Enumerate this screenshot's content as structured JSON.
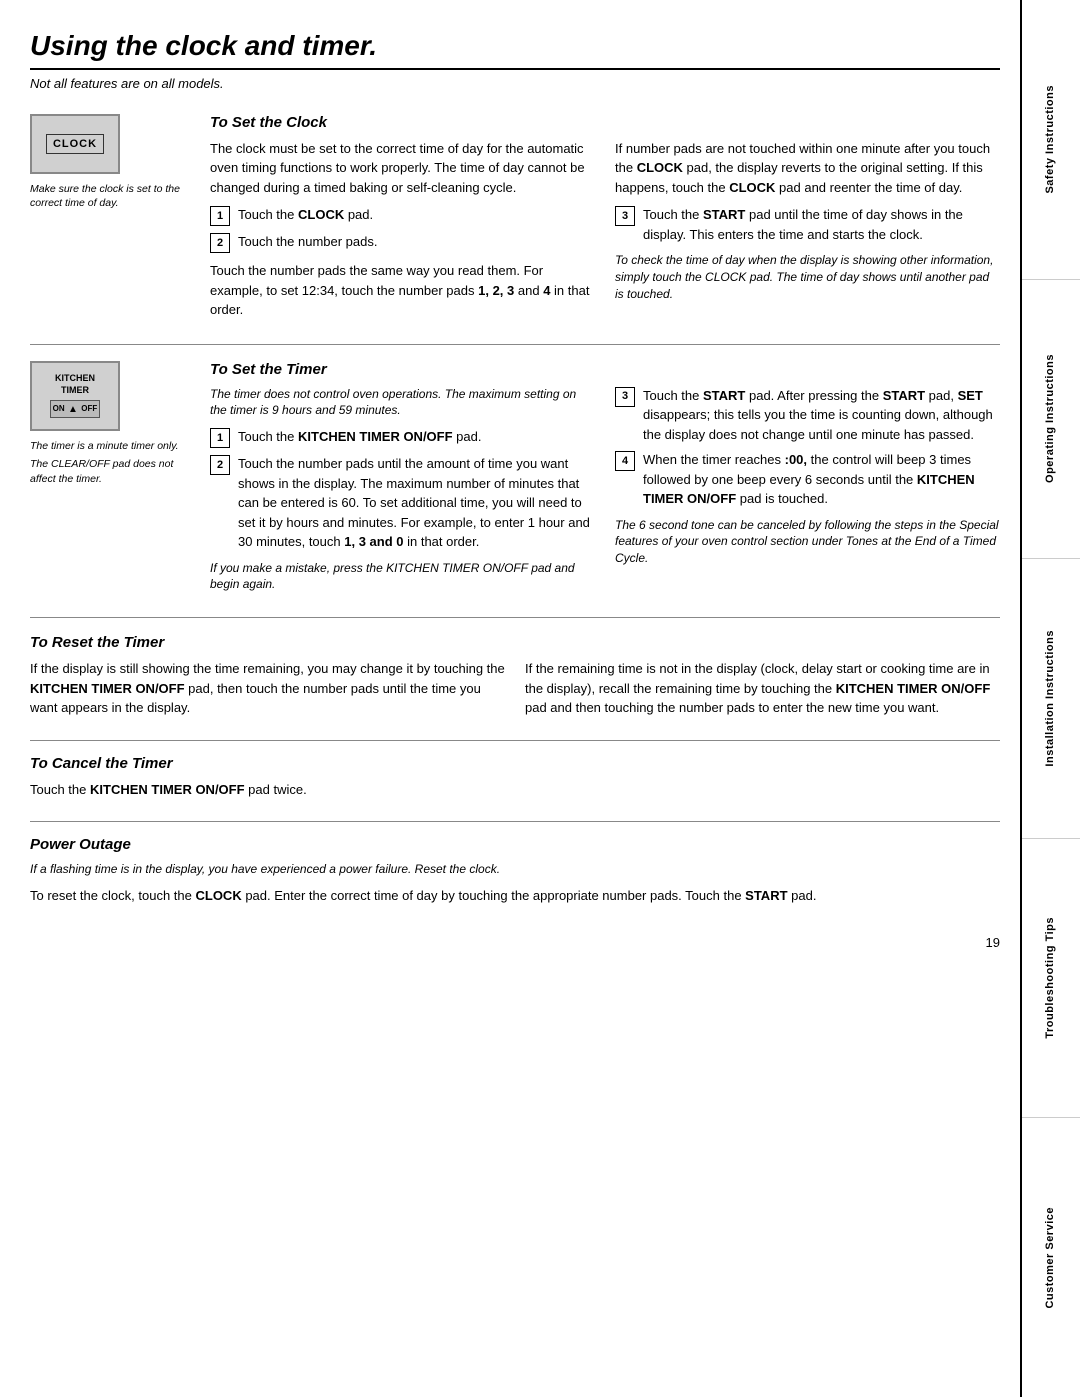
{
  "page": {
    "title": "Using the clock and timer.",
    "subtitle": "Not all features are on all models.",
    "page_number": "19"
  },
  "sidebar": {
    "sections": [
      {
        "label": "Safety Instructions"
      },
      {
        "label": "Operating Instructions"
      },
      {
        "label": "Installation Instructions"
      },
      {
        "label": "Troubleshooting Tips"
      },
      {
        "label": "Customer Service"
      }
    ]
  },
  "set_clock": {
    "title": "To Set the Clock",
    "clock_label": "CLOCK",
    "image_caption": "Make sure the clock is set to the correct time of day.",
    "left_body": "The clock must be set to the correct time of day for the automatic oven timing functions to work properly. The time of day cannot be changed during a timed baking or self-cleaning cycle.",
    "steps": [
      {
        "num": "1",
        "text_plain": "Touch the ",
        "text_bold": "CLOCK",
        "text_after": " pad."
      },
      {
        "num": "2",
        "text_plain": "Touch the number pads."
      }
    ],
    "mid_para": "Touch the number pads the same way you read them. For example, to set 12:34, touch the number pads 1, 2, 3 and 4 in that order.",
    "right_body": "If number pads are not touched within one minute after you touch the CLOCK pad, the display reverts to the original setting. If this happens, touch the CLOCK pad and reenter the time of day.",
    "right_step3_plain": "Touch the ",
    "right_step3_bold": "START",
    "right_step3_after": " pad until the time of day shows in the display. This enters the time and starts the clock.",
    "right_note": "To check the time of day when the display is showing other information, simply touch the CLOCK pad. The time of day shows until another pad is touched."
  },
  "set_timer": {
    "title": "To Set the Timer",
    "timer_label1": "KITCHEN",
    "timer_label2": "TIMER",
    "timer_label3": "ON",
    "timer_label4": "OFF",
    "caption1": "The timer is a minute timer only.",
    "caption2": "The CLEAR/OFF pad does not affect the timer.",
    "italic_note": "The timer does not control oven operations. The maximum setting on the timer is 9 hours and 59 minutes.",
    "step1_bold": "KITCHEN TIMER ON/OFF",
    "step1_after": " pad.",
    "step2_text": "Touch the number pads until the amount of time you want shows in the display. The maximum number of minutes that can be entered is 60. To set additional time, you will need to set it by hours and minutes. For example, to enter 1 hour and 30 minutes, touch ",
    "step2_bold": "1, 3 and 0",
    "step2_after": " in that order.",
    "mistake_note": "If you make a mistake, press the KITCHEN TIMER ON/OFF pad and begin again.",
    "right_step3_plain": "Touch the ",
    "right_step3_bold": "START",
    "right_step3_after": " pad. After pressing the ",
    "right_step3_bold2": "START",
    "right_step3_mid": " pad, ",
    "right_step3_bold3": "SET",
    "right_step3_end": " disappears; this tells you the time is counting down, although the display does not change until one minute has passed.",
    "right_step4_plain": "When the timer reaches ",
    "right_step4_bold": ":00,",
    "right_step4_after": " the control will beep 3 times followed by one beep every 6 seconds until the ",
    "right_step4_bold2": "KITCHEN TIMER ON/OFF",
    "right_step4_end": " pad is touched.",
    "right_italic_note": "The 6 second tone can be canceled by following the steps in the Special features of your oven control section under Tones at the End of a Timed Cycle."
  },
  "reset_timer": {
    "title": "To Reset the Timer",
    "left_text": "If the display is still showing the time remaining, you may change it by touching the ",
    "left_bold1": "KITCHEN TIMER ON/OFF",
    "left_mid": " pad, then touch the number pads until the time you want appears in the display.",
    "right_text": "If the remaining time is not in the display (clock, delay start or cooking time are in the display), recall the remaining time by touching the ",
    "right_bold": "KITCHEN TIMER ON/OFF",
    "right_after": " pad and then touching the number pads to enter the new time you want."
  },
  "cancel_timer": {
    "title": "To Cancel the Timer",
    "text_plain": "Touch the ",
    "text_bold": "KITCHEN TIMER ON/OFF",
    "text_after": " pad twice."
  },
  "power_outage": {
    "title": "Power Outage",
    "italic_note": "If a flashing time is in the display, you have experienced a power failure. Reset the clock.",
    "body_plain": "To reset the clock, touch the ",
    "body_bold": "CLOCK",
    "body_mid": " pad. Enter the correct time of day by touching the appropriate number pads. Touch the ",
    "body_bold2": "START",
    "body_end": " pad."
  }
}
